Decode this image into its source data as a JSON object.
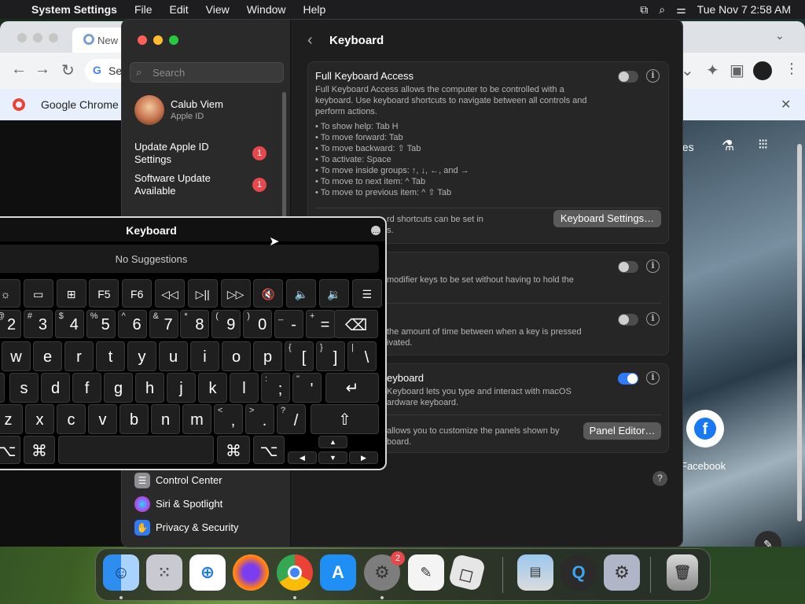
{
  "menubar": {
    "apple": "",
    "app_name": "System Settings",
    "menus": [
      "File",
      "Edit",
      "View",
      "Window",
      "Help"
    ],
    "clock": "Tue Nov 7  2:58 AM"
  },
  "chrome": {
    "tab_label": "New",
    "omnibox": "Se",
    "infobar": "Google Chrome",
    "partial_text": "ges",
    "shortcut_label": "Facebook"
  },
  "sidebar": {
    "search_placeholder": "Search",
    "user_name": "Calub Viem",
    "user_sub": "Apple ID",
    "notices": [
      {
        "label_1": "Update Apple ID",
        "label_2": "Settings",
        "badge": "1"
      },
      {
        "label_1": "Software Update",
        "label_2": "Available",
        "badge": "1"
      }
    ],
    "items": [
      {
        "label": "Control Center",
        "color": "#8e8e93"
      },
      {
        "label": "Siri & Spotlight",
        "color": "#a64cf0"
      },
      {
        "label": "Privacy & Security",
        "color": "#2f7cf6"
      }
    ]
  },
  "main": {
    "title": "Keyboard",
    "fka": {
      "title": "Full Keyboard Access",
      "desc_1": "Full Keyboard Access allows the computer to be controlled with a",
      "desc_2": "keyboard. Use keyboard shortcuts to navigate between all controls and",
      "desc_3": "perform actions.",
      "tips": [
        "• To show help: Tab H",
        "• To move forward: Tab",
        "• To move backward: ⇧ Tab",
        "• To activate: Space",
        "• To move inside groups: ↑, ↓, ←, and →",
        "• To move to next item: ^ Tab",
        "• To move to previous item: ^ ⇧ Tab"
      ],
      "shortcuts_text_1": "rd shortcuts can be set in",
      "shortcuts_text_2": "s.",
      "button": "Keyboard Settings…",
      "toggle_on": false
    },
    "sticky": {
      "text": "modifier keys to be set without having to hold the",
      "toggle_on": false
    },
    "slow": {
      "text_1": "the amount of time between when a key is pressed",
      "text_2": "ivated.",
      "toggle_on": false
    },
    "akv": {
      "title": "eyboard",
      "text_1": "Keyboard lets you type and interact with macOS",
      "text_2": "ardware keyboard.",
      "text_3": "allows you to customize the panels shown by",
      "text_4": "board.",
      "button": "Panel Editor…",
      "toggle_on": true
    },
    "help": "?"
  },
  "keyboard_viewer": {
    "title": "Keyboard",
    "suggestions": "No Suggestions",
    "fn_row": [
      "☼",
      "▭",
      "⊞",
      "F5",
      "F6",
      "◁◁",
      "▷||",
      "▷▷",
      "🔇",
      "🔈",
      "🔉",
      "☰"
    ],
    "num_row": [
      {
        "s": "@",
        "m": "2"
      },
      {
        "s": "#",
        "m": "3"
      },
      {
        "s": "$",
        "m": "4"
      },
      {
        "s": "%",
        "m": "5"
      },
      {
        "s": "^",
        "m": "6"
      },
      {
        "s": "&",
        "m": "7"
      },
      {
        "s": "*",
        "m": "8"
      },
      {
        "s": "(",
        "m": "9"
      },
      {
        "s": ")",
        "m": "0"
      },
      {
        "s": "_",
        "m": "-"
      },
      {
        "s": "+",
        "m": "="
      }
    ],
    "delete": "⌫",
    "row_q": [
      "w",
      "e",
      "r",
      "t",
      "y",
      "u",
      "i",
      "o",
      "p"
    ],
    "row_q_sym": [
      {
        "s": "{",
        "m": "["
      },
      {
        "s": "}",
        "m": "]"
      },
      {
        "s": "|",
        "m": "\\"
      }
    ],
    "row_a": [
      "s",
      "d",
      "f",
      "g",
      "h",
      "j",
      "k",
      "l"
    ],
    "row_a_sym": [
      {
        "s": ":",
        "m": ";"
      },
      {
        "s": "\"",
        "m": "'"
      }
    ],
    "return": "↵",
    "row_z": [
      "z",
      "x",
      "c",
      "v",
      "b",
      "n",
      "m"
    ],
    "row_z_sym": [
      {
        "s": "<",
        "m": ","
      },
      {
        "s": ">",
        "m": "."
      },
      {
        "s": "?",
        "m": "/"
      }
    ],
    "shift": "⇧",
    "bottom": {
      "opt_l": "⌥",
      "cmd_l": "⌘",
      "cmd_r": "⌘",
      "opt_r": "⌥",
      "up": "▲",
      "left": "◀",
      "down": "▼",
      "right": "▶"
    }
  },
  "dock": {
    "system_settings_badge": "2",
    "apps": [
      "Finder",
      "Launchpad",
      "Safari",
      "Firefox",
      "Chrome",
      "App Store",
      "System Settings",
      "TextEdit",
      "Roblox",
      "Preview",
      "QuickTime",
      "Settings",
      "Trash"
    ]
  }
}
